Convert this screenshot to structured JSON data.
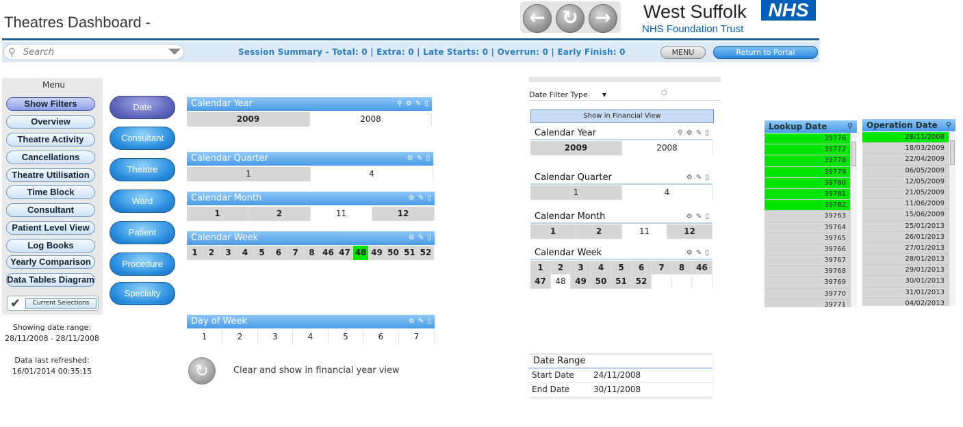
{
  "header": {
    "title": "Theatres Dashboard -",
    "logo_name": "West Suffolk",
    "logo_nhs": "NHS",
    "logo_trust": "NHS Foundation Trust"
  },
  "nav": {
    "back_icon": "arrow-left-icon",
    "refresh_icon": "refresh-icon",
    "forward_icon": "arrow-right-icon"
  },
  "toolbar": {
    "search_placeholder": "Search",
    "summary": "Session Summary - Total: 0  |  Extra: 0  |  Late Starts: 0  |  Overrun: 0  |  Early Finish: 0",
    "menu_label": "MENU",
    "portal_label": "Return to Portal"
  },
  "menu": {
    "title": "Menu",
    "items": [
      "Show Filters",
      "Overview",
      "Theatre Activity",
      "Cancellations",
      "Theatre Utilisation",
      "Time Block",
      "Consultant",
      "Patient Level View",
      "Log Books",
      "Yearly Comparison",
      "Data Tables Diagram"
    ],
    "current_selections": "Current Selections",
    "showing_label": "Showing date range:",
    "showing_value": "28/11/2008 - 28/11/2008",
    "refreshed_label": "Data last refreshed:",
    "refreshed_value": "16/01/2014 00:35:15"
  },
  "filter_tabs": [
    "Date",
    "Consultant",
    "Theatre",
    "Ward",
    "Patient",
    "Procedure",
    "Specialty"
  ],
  "left_lists": {
    "year": {
      "title": "Calendar Year",
      "values": [
        "2009",
        "2008"
      ]
    },
    "quarter": {
      "title": "Calendar Quarter",
      "values": [
        "1",
        "4"
      ]
    },
    "month": {
      "title": "Calendar Month",
      "values": [
        "1",
        "2",
        "11",
        "12"
      ]
    },
    "week": {
      "title": "Calendar Week",
      "values": [
        "1",
        "2",
        "3",
        "4",
        "5",
        "6",
        "7",
        "8",
        "46",
        "47",
        "48",
        "49",
        "50",
        "51",
        "52"
      ],
      "selected": "48"
    },
    "dow": {
      "title": "Day of Week",
      "values": [
        "1",
        "2",
        "3",
        "4",
        "5",
        "6",
        "7"
      ]
    }
  },
  "clear_label": "Clear and show in financial year view",
  "right_filters": {
    "date_filter_type": "Date Filter Type",
    "show_financial": "Show in Financial View",
    "year": {
      "title": "Calendar Year",
      "values": [
        "2009",
        "2008"
      ]
    },
    "quarter": {
      "title": "Calendar Quarter",
      "values": [
        "1",
        "4"
      ]
    },
    "month": {
      "title": "Calendar Month",
      "values": [
        "1",
        "2",
        "11",
        "12"
      ]
    },
    "week": {
      "title": "Calendar Week",
      "row1": [
        "1",
        "2",
        "3",
        "4",
        "5",
        "6",
        "7",
        "8",
        "46"
      ],
      "row2": [
        "47",
        "48",
        "49",
        "50",
        "51",
        "52"
      ]
    }
  },
  "date_range": {
    "title": "Date Range",
    "start_label": "Start Date",
    "start_value": "24/11/2008",
    "end_label": "End Date",
    "end_value": "30/11/2008"
  },
  "lookup_date": {
    "title": "Lookup Date",
    "rows": [
      "39776",
      "39777",
      "39778",
      "39779",
      "39780",
      "39781",
      "39782",
      "39763",
      "39764",
      "39765",
      "39766",
      "39767",
      "39768",
      "39769",
      "39770",
      "39771"
    ],
    "green_count": 7
  },
  "operation_date": {
    "title": "Operation Date",
    "rows": [
      "28/11/2008",
      "18/03/2009",
      "22/04/2009",
      "06/05/2009",
      "12/05/2009",
      "21/05/2009",
      "11/06/2009",
      "15/06/2009",
      "25/01/2013",
      "26/01/2013",
      "27/01/2013",
      "28/01/2013",
      "29/01/2013",
      "30/01/2013",
      "31/01/2013",
      "04/02/2013"
    ],
    "green_count": 1
  },
  "colors": {
    "accent": "#2a7cc0",
    "selected_green": "#00e600",
    "nhs_blue": "#005eb8"
  }
}
